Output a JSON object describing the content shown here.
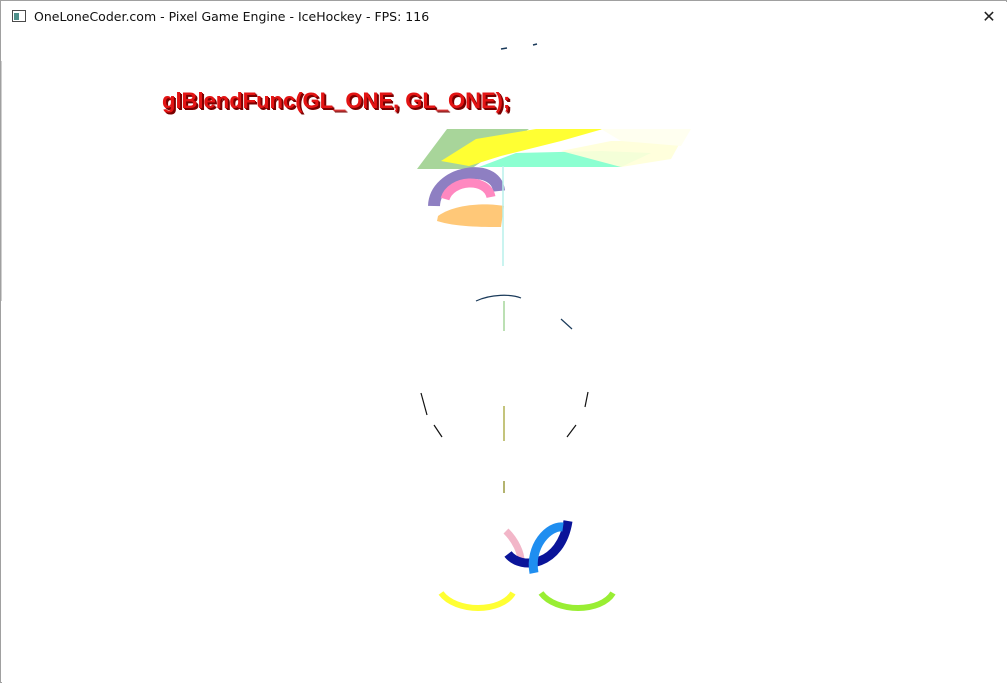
{
  "window": {
    "title": "OneLoneCoder.com - Pixel Game Engine - IceHockey - FPS: 116",
    "close_glyph": "✕"
  },
  "canvas": {
    "overlay_text": "glBlendFunc(GL_ONE, GL_ONE);",
    "overlay_color": "#e31414"
  },
  "colors": {
    "yellow": "#ffff33",
    "green": "#a8d59a",
    "aqua": "#80ffcc",
    "purple": "#8e7fc2",
    "pink": "#ff88c0",
    "orange": "#ffc878",
    "navy": "#0a1499",
    "blue": "#1f8ef0",
    "lime": "#99ee33",
    "line": "#1a1a1a"
  }
}
